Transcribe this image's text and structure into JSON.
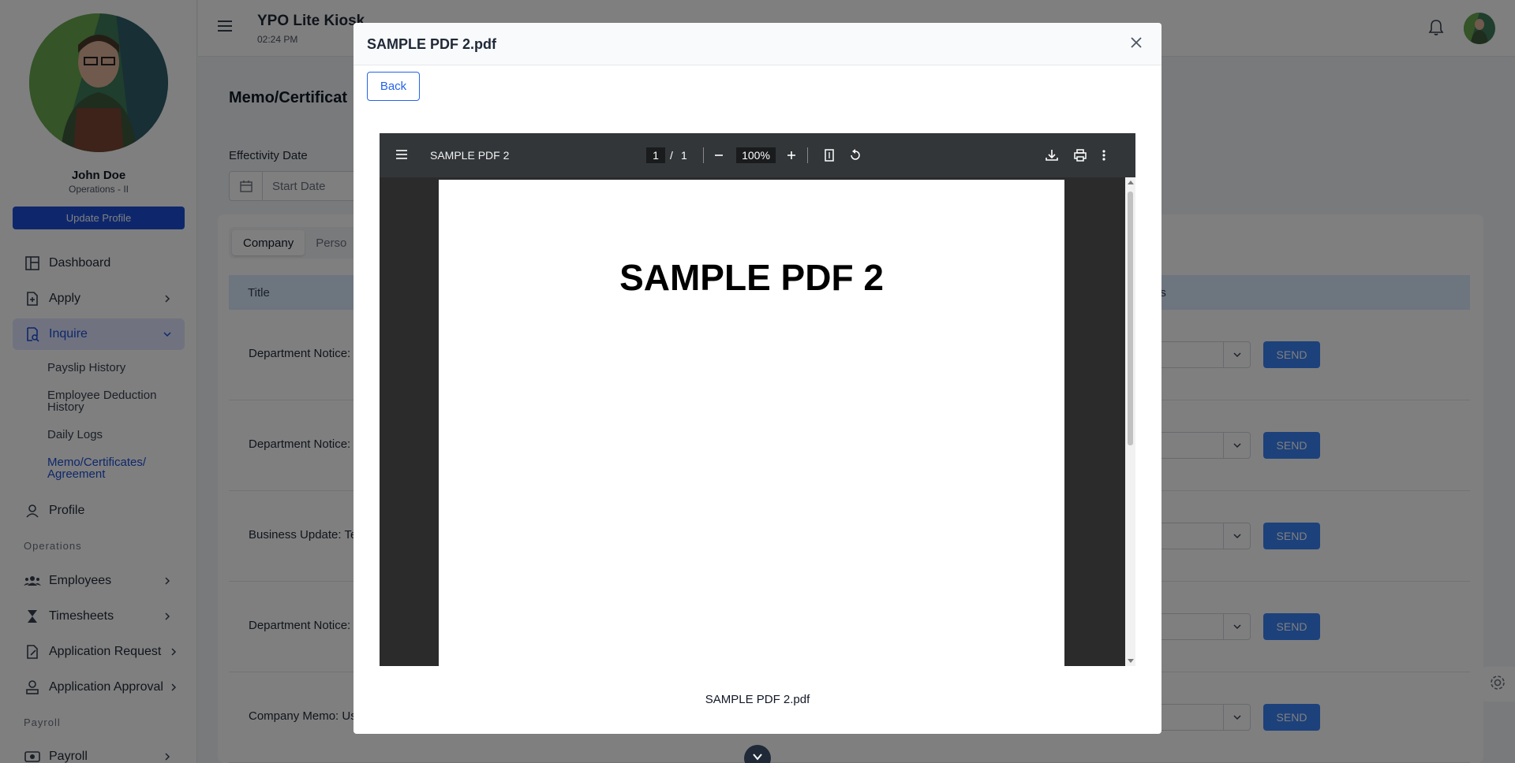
{
  "app": {
    "title": "YPO Lite Kiosk",
    "time": "02:24 PM"
  },
  "profile": {
    "name": "John Doe",
    "role": "Operations - II",
    "update_label": "Update Profile"
  },
  "sidebar": {
    "items": [
      {
        "label": "Dashboard",
        "icon": "dashboard-icon"
      },
      {
        "label": "Apply",
        "icon": "file-plus-icon"
      },
      {
        "label": "Inquire",
        "icon": "search-doc-icon"
      },
      {
        "label": "Profile",
        "icon": "user-icon"
      },
      {
        "label": "Employees",
        "icon": "users-icon"
      },
      {
        "label": "Timesheets",
        "icon": "hourglass-icon"
      },
      {
        "label": "Application Request",
        "icon": "file-edit-icon"
      },
      {
        "label": "Application Approval",
        "icon": "user-check-icon"
      },
      {
        "label": "Payroll",
        "icon": "money-icon"
      }
    ],
    "sub_items": [
      "Payslip History",
      "Employee Deduction History",
      "Daily Logs",
      "Memo/Certificates/ Agreement"
    ],
    "sections": [
      "Operations",
      "Payroll"
    ]
  },
  "main": {
    "page_title": "Memo/Certificat",
    "effectivity_label": "Effectivity Date",
    "start_date_placeholder": "Start Date",
    "tabs": [
      "Company",
      "Perso"
    ],
    "columns": [
      "Title",
      "nse/s"
    ],
    "rows": [
      {
        "title": "Department Notice:",
        "action": "SEND"
      },
      {
        "title": "Department Notice:",
        "action": "SEND"
      },
      {
        "title": "Business Update: Te",
        "action": "SEND"
      },
      {
        "title": "Department Notice:",
        "action": "SEND"
      },
      {
        "title": "Company Memo: Us",
        "action": "SEND"
      }
    ]
  },
  "modal": {
    "title": "SAMPLE PDF 2.pdf",
    "back_label": "Back",
    "caption": "SAMPLE PDF 2.pdf"
  },
  "pdf": {
    "doc_name": "SAMPLE PDF 2",
    "page": "1",
    "separator": "/",
    "total": "1",
    "zoom": "100%",
    "heading": "SAMPLE PDF 2"
  },
  "colors": {
    "primary": "#1d4ed8",
    "send": "#3b82f6",
    "table_head": "#dbeafe",
    "pdf_toolbar": "#323639"
  }
}
